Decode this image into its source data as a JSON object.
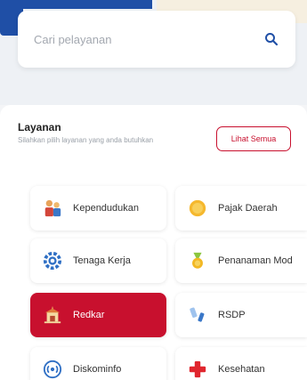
{
  "search": {
    "placeholder": "Cari pelayanan",
    "icon": "search-icon"
  },
  "services": {
    "title": "Layanan",
    "subtitle": "Silahkan pilih layanan yang anda butuhkan",
    "see_all_label": "Lihat Semua",
    "items": [
      {
        "label": "Kependudukan",
        "icon": "family-icon"
      },
      {
        "label": "Pajak Daerah",
        "icon": "coin-icon"
      },
      {
        "label": "Tenaga Kerja",
        "icon": "gear-icon"
      },
      {
        "label": "Penanaman Mod",
        "icon": "medal-icon"
      },
      {
        "label": "Redkar",
        "icon": "fire-station-icon",
        "active": true
      },
      {
        "label": "RSDP",
        "icon": "syringe-icon"
      },
      {
        "label": "Diskominfo",
        "icon": "broadcast-icon"
      },
      {
        "label": "Kesehatan",
        "icon": "medical-cross-icon"
      }
    ]
  },
  "colors": {
    "primary_blue": "#1f4fa6",
    "accent_red": "#c8102e"
  }
}
